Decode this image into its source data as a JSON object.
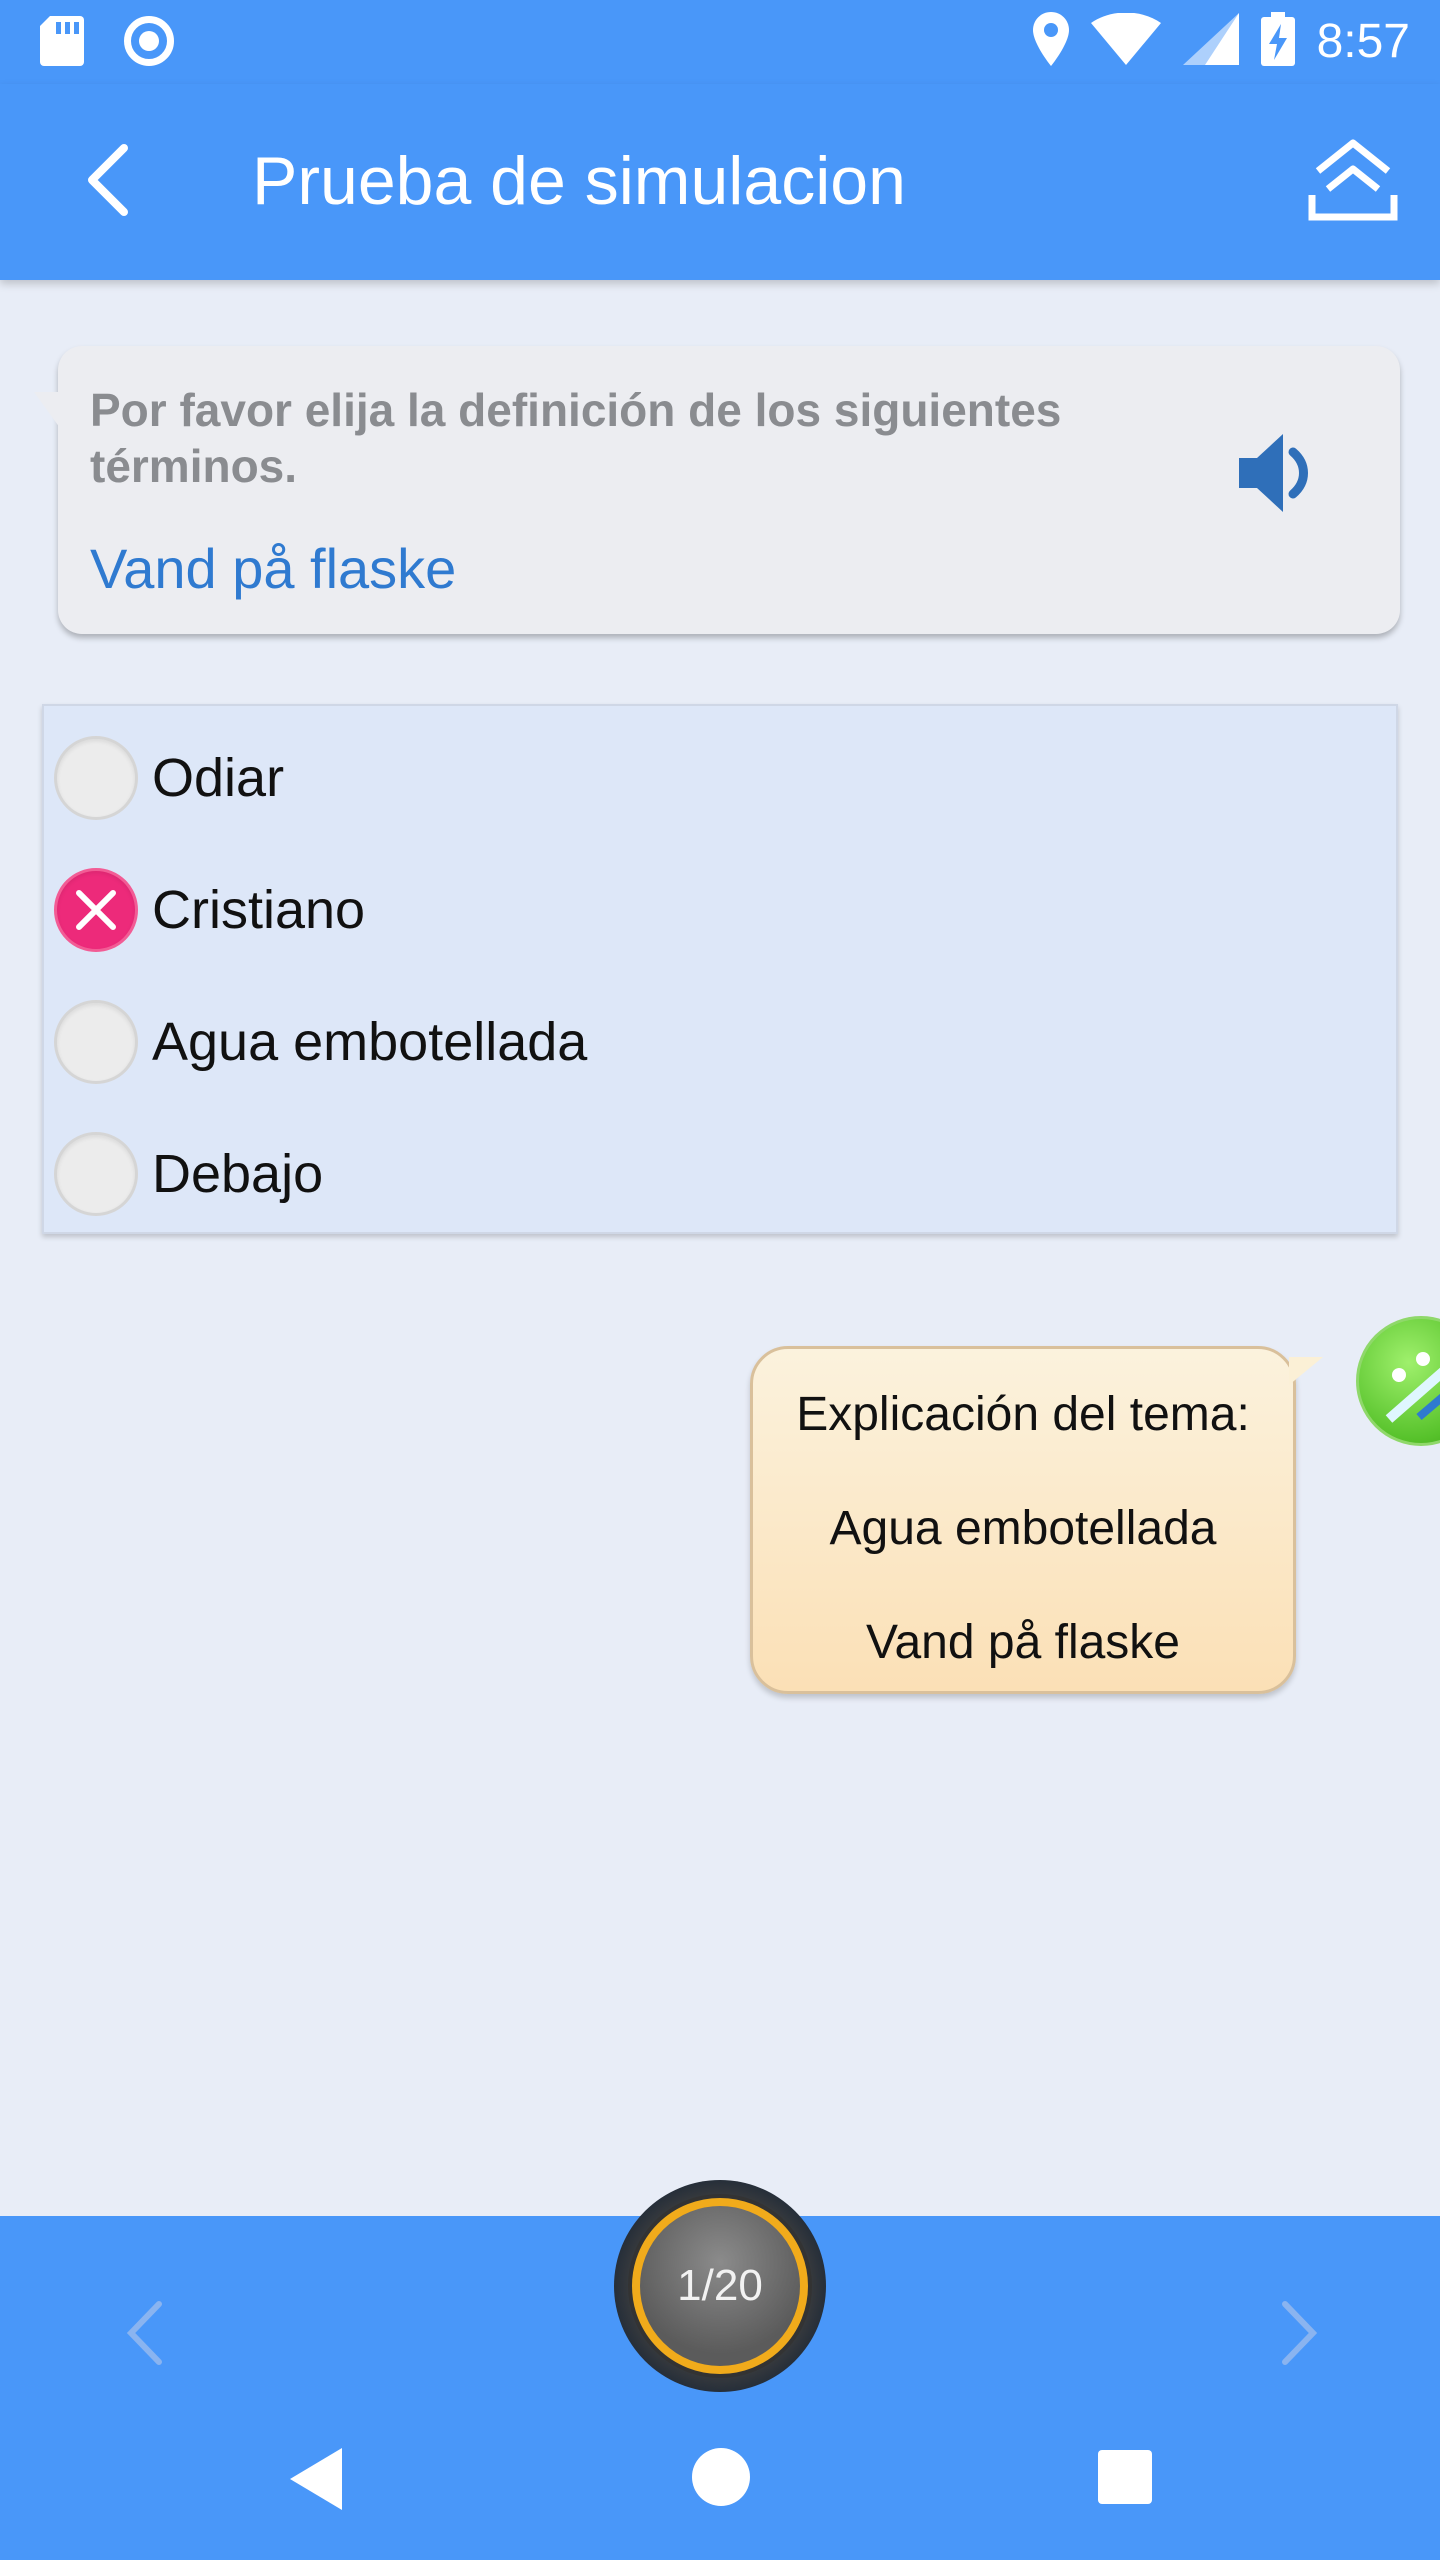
{
  "status_bar": {
    "time": "8:57",
    "icons": [
      "sd-card-icon",
      "sync-circle-icon",
      "location-icon",
      "wifi-icon",
      "signal-icon",
      "battery-charging-icon"
    ]
  },
  "app_bar": {
    "title": "Prueba de simulacion",
    "back_icon": "chevron-left-icon",
    "share_icon": "upload-icon"
  },
  "question": {
    "prompt": "Por favor elija la definición de los siguientes términos.",
    "term": "Vand på flaske",
    "audio_icon": "speaker-icon"
  },
  "options": [
    {
      "label": "Odiar",
      "state": "unselected"
    },
    {
      "label": "Cristiano",
      "state": "wrong"
    },
    {
      "label": "Agua embotellada",
      "state": "unselected"
    },
    {
      "label": "Debajo",
      "state": "unselected"
    }
  ],
  "explanation": {
    "heading": "Explicación del tema:",
    "answer": "Agua embotellada",
    "term": "Vand på flaske"
  },
  "bottom_bar": {
    "counter": "1/20",
    "prev_icon": "chevron-left-icon",
    "next_icon": "chevron-right-icon"
  },
  "system_nav": {
    "icons": [
      "back-triangle-icon",
      "home-circle-icon",
      "recents-square-icon"
    ]
  },
  "colors": {
    "primary": "#4997f9",
    "background": "#e8edf7",
    "wrong": "#ed2a7a",
    "term": "#2f7ad0",
    "counter_ring": "#f1ab1b"
  }
}
